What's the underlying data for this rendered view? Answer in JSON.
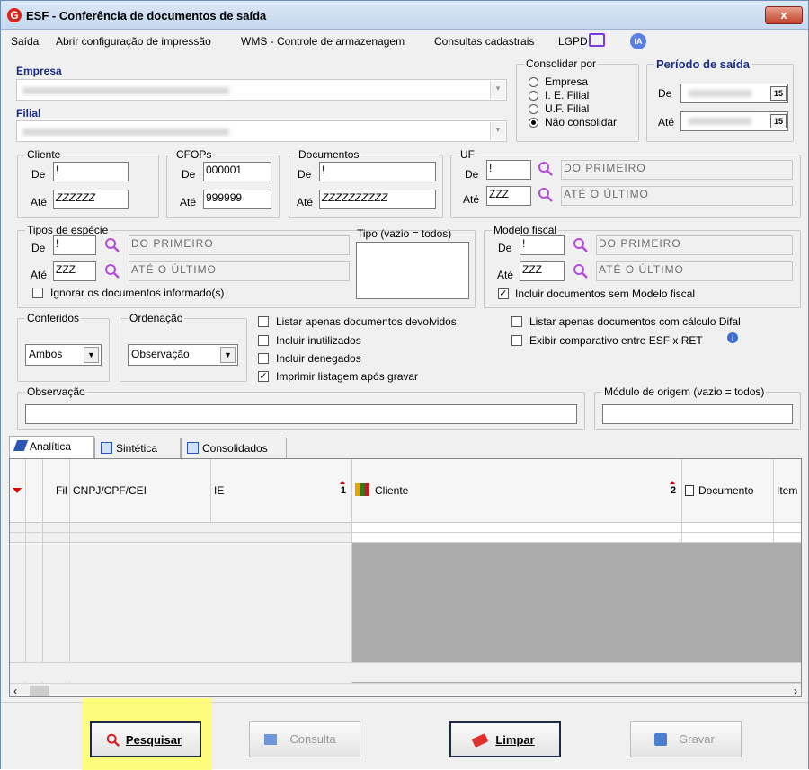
{
  "window": {
    "title": "ESF - Conferência de documentos de saída",
    "close_label": "x"
  },
  "menu": {
    "items": [
      {
        "label": "Saída"
      },
      {
        "label": "Abrir configuração de impressão"
      },
      {
        "label": "WMS - Controle de armazenagem"
      },
      {
        "label": "Consultas cadastrais"
      },
      {
        "label": "LGPD"
      },
      {
        "label": "IA"
      }
    ]
  },
  "empresa": {
    "label": "Empresa",
    "value": ""
  },
  "filial": {
    "label": "Filial",
    "value": ""
  },
  "consolidar": {
    "legend": "Consolidar por",
    "options": [
      "Empresa",
      "I. E. Filial",
      "U.F. Filial",
      "Não consolidar"
    ],
    "selected": "Não consolidar"
  },
  "periodo": {
    "legend": "Período de saída",
    "de_label": "De",
    "ate_label": "Até",
    "cal_label": "15"
  },
  "cliente": {
    "legend": "Cliente",
    "de_label": "De",
    "de_value": "!",
    "ate_label": "Até",
    "ate_value": "ZZZZZZ"
  },
  "cfops": {
    "legend": "CFOPs",
    "de_label": "De",
    "de_value": "000001",
    "ate_label": "Até",
    "ate_value": "999999"
  },
  "documentos": {
    "legend": "Documentos",
    "de_label": "De",
    "de_value": "!",
    "ate_label": "Até",
    "ate_value": "ZZZZZZZZZZ"
  },
  "uf": {
    "legend": "UF",
    "de_label": "De",
    "de_value": "!",
    "de_desc": "DO PRIMEIRO",
    "ate_label": "Até",
    "ate_value": "ZZZ",
    "ate_desc": "ATÉ O ÚLTIMO"
  },
  "tipos_especie": {
    "legend": "Tipos de espécie",
    "de_label": "De",
    "de_value": "!",
    "de_desc": "DO PRIMEIRO",
    "ate_label": "Até",
    "ate_value": "ZZZ",
    "ate_desc": "ATÉ O ÚLTIMO",
    "ignore_label": "Ignorar os documentos informado(s)",
    "tipo_label": "Tipo (vazio = todos)"
  },
  "modelo_fiscal": {
    "legend": "Modelo fiscal",
    "de_label": "De",
    "de_value": "!",
    "de_desc": "DO PRIMEIRO",
    "ate_label": "Até",
    "ate_value": "ZZZ",
    "ate_desc": "ATÉ O ÚLTIMO",
    "include_label": "Incluir documentos sem Modelo fiscal"
  },
  "conferidos": {
    "legend": "Conferidos",
    "value": "Ambos"
  },
  "ordenacao": {
    "legend": "Ordenação",
    "value": "Observação"
  },
  "options": {
    "listar_devolvidos": "Listar apenas documentos devolvidos",
    "incluir_inutilizados": "Incluir inutilizados",
    "incluir_denegados": "Incluir denegados",
    "imprimir_listagem": "Imprimir listagem após gravar",
    "listar_difal": "Listar apenas documentos com cálculo Difal",
    "exibir_comparativo": "Exibir comparativo entre ESF x RET"
  },
  "observacao": {
    "legend": "Observação",
    "value": ""
  },
  "modulo_origem": {
    "legend": "Módulo de origem (vazio = todos)",
    "value": ""
  },
  "tabs": [
    {
      "label": "Analítica"
    },
    {
      "label": "Sintética"
    },
    {
      "label": "Consolidados"
    }
  ],
  "grid": {
    "columns": [
      "Fil",
      "CNPJ/CPF/CEI",
      "IE",
      "Cliente",
      "Documento",
      "Item"
    ],
    "sort_ie": "1",
    "sort_cliente": "2"
  },
  "buttons": {
    "pesquisar": "Pesquisar",
    "consulta": "Consulta",
    "limpar": "Limpar",
    "gravar": "Gravar"
  }
}
